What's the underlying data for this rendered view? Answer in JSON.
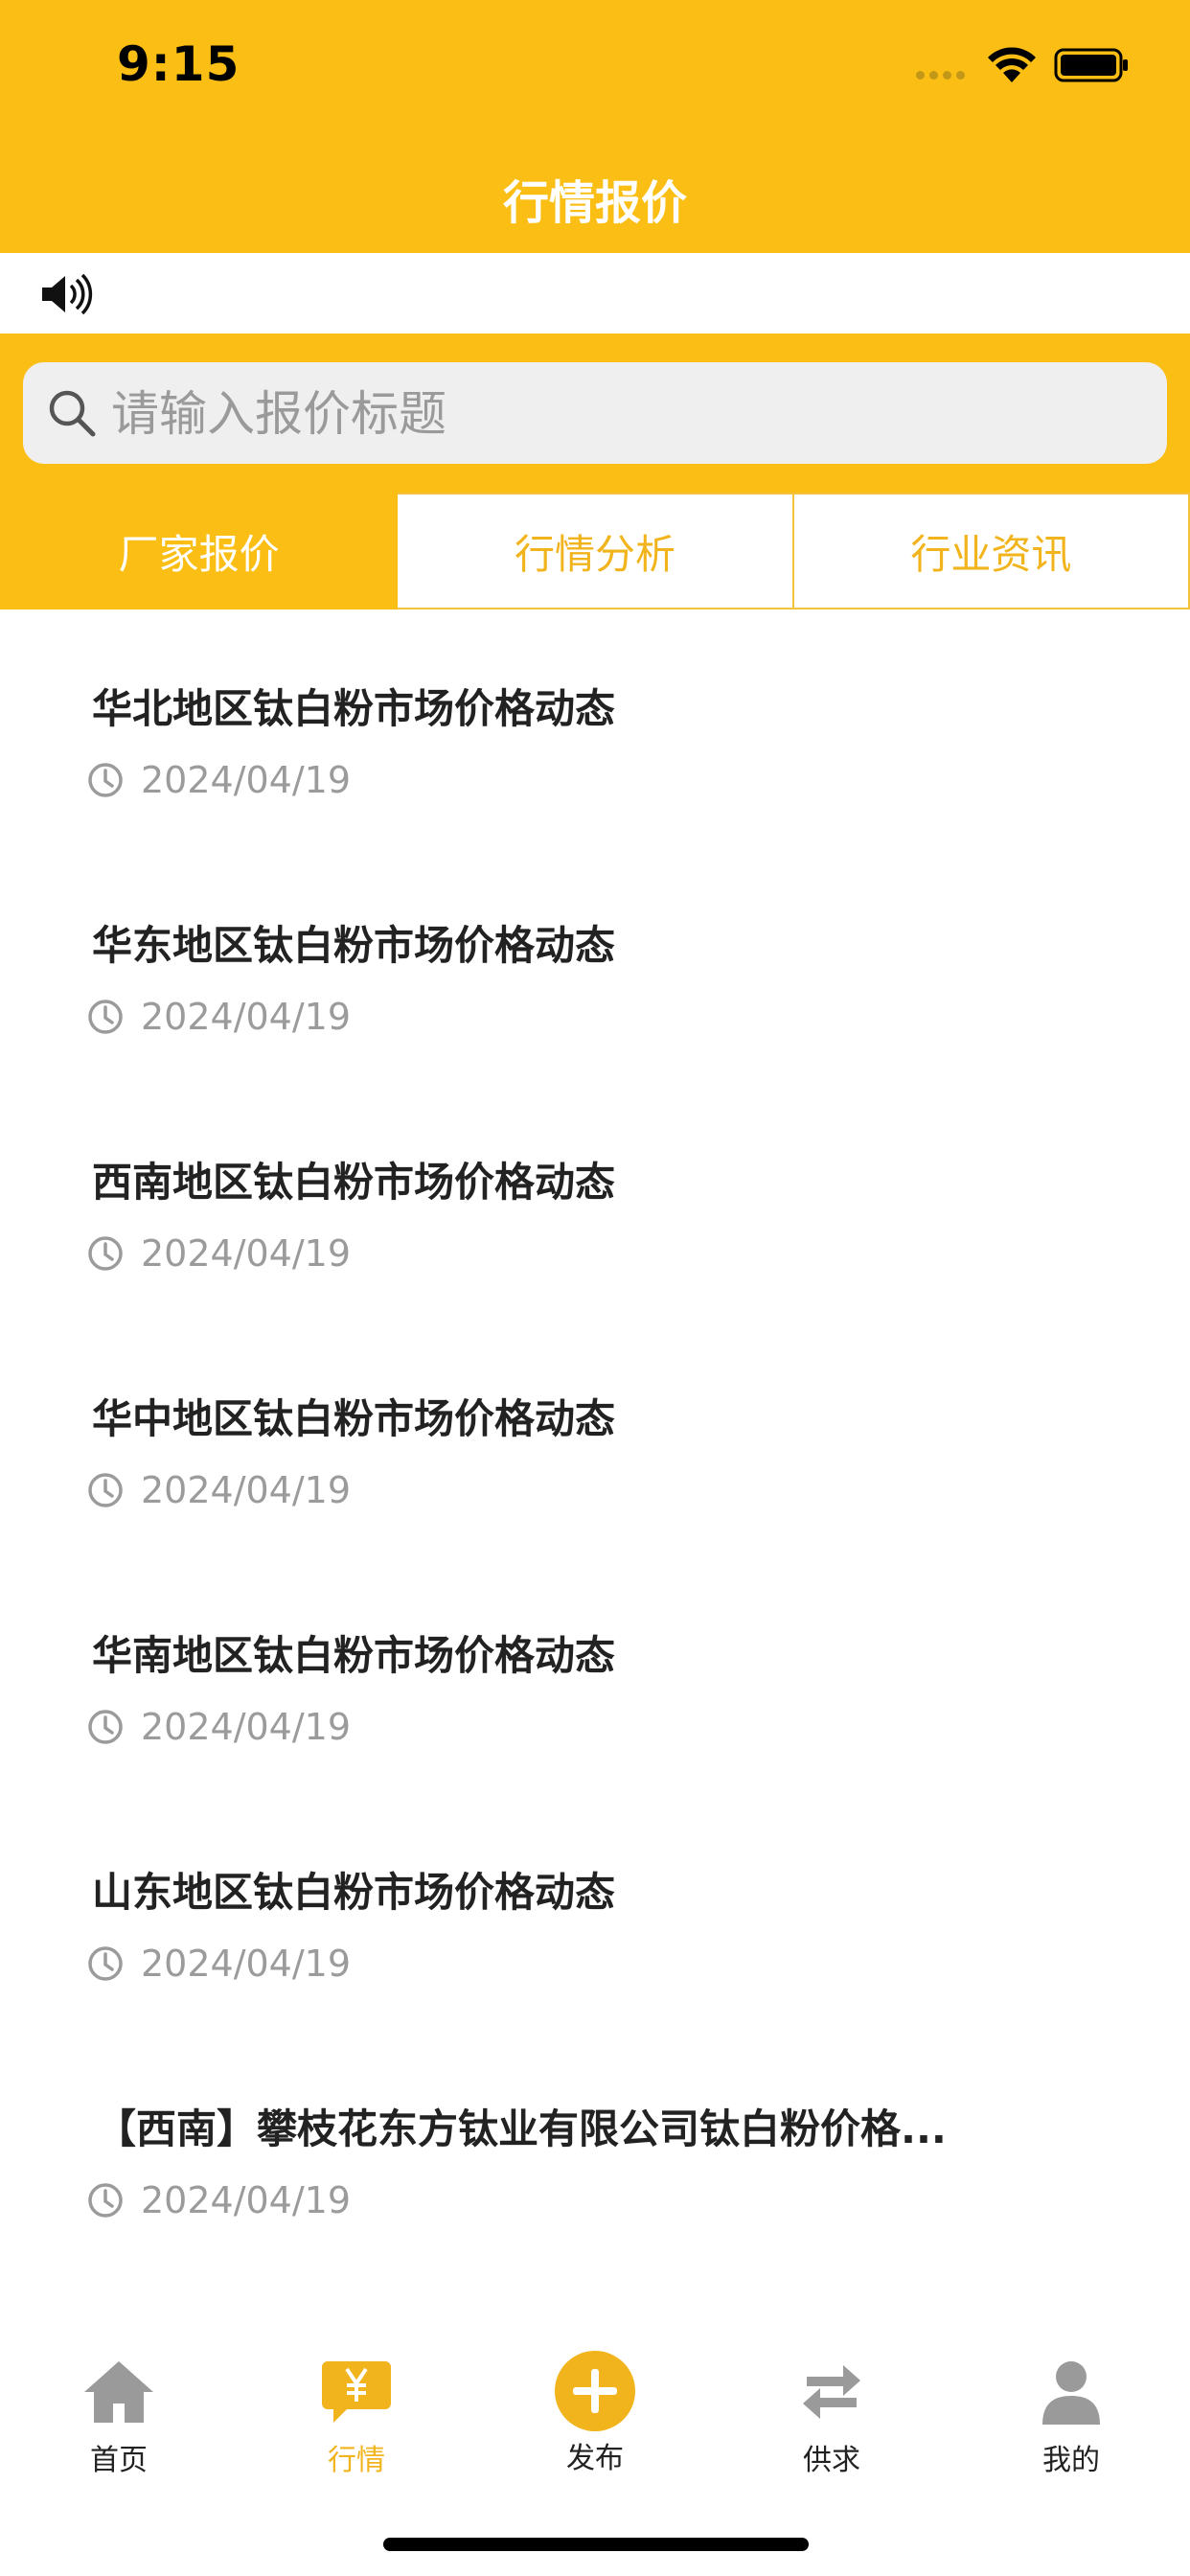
{
  "status_bar": {
    "time": "9:15"
  },
  "nav": {
    "title": "行情报价"
  },
  "search": {
    "placeholder": "请输入报价标题"
  },
  "tabs": [
    {
      "label": "厂家报价",
      "active": true
    },
    {
      "label": "行情分析",
      "active": false
    },
    {
      "label": "行业资讯",
      "active": false
    }
  ],
  "items": [
    {
      "title": "华北地区钛白粉市场价格动态",
      "date": "2024/04/19"
    },
    {
      "title": "华东地区钛白粉市场价格动态",
      "date": "2024/04/19"
    },
    {
      "title": "西南地区钛白粉市场价格动态",
      "date": "2024/04/19"
    },
    {
      "title": "华中地区钛白粉市场价格动态",
      "date": "2024/04/19"
    },
    {
      "title": "华南地区钛白粉市场价格动态",
      "date": "2024/04/19"
    },
    {
      "title": "山东地区钛白粉市场价格动态",
      "date": "2024/04/19"
    },
    {
      "title": "【西南】攀枝花东方钛业有限公司钛白粉价格...",
      "date": "2024/04/19"
    }
  ],
  "tabbar": [
    {
      "label": "首页",
      "icon": "home-icon"
    },
    {
      "label": "行情",
      "icon": "market-icon",
      "active": true
    },
    {
      "label": "发布",
      "icon": "publish-plus-icon"
    },
    {
      "label": "供求",
      "icon": "swap-arrows-icon"
    },
    {
      "label": "我的",
      "icon": "user-icon"
    }
  ],
  "colors": {
    "brand": "#FBBE14",
    "tab_text": "#F2B41C",
    "date_text": "#9B9B9B"
  }
}
